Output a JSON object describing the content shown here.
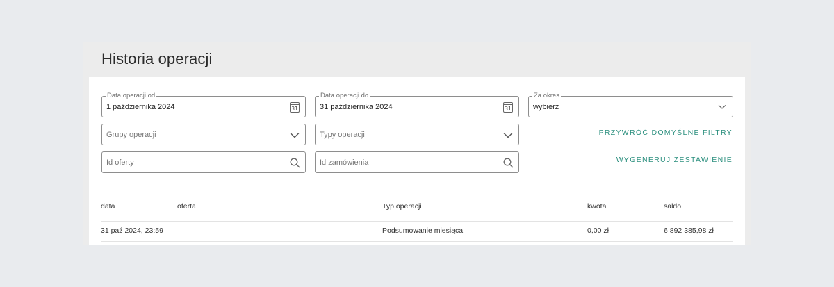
{
  "page": {
    "title": "Historia operacji"
  },
  "filters": {
    "date_from": {
      "label": "Data operacji od",
      "value": "1 października 2024",
      "icon": "calendar-icon",
      "icon_text": "31"
    },
    "date_to": {
      "label": "Data operacji do",
      "value": "31 października 2024",
      "icon": "calendar-icon",
      "icon_text": "31"
    },
    "period": {
      "label": "Za okres",
      "value": "wybierz",
      "icon": "chevron-down-icon"
    },
    "operation_groups": {
      "placeholder": "Grupy operacji",
      "icon": "chevron-down-icon"
    },
    "operation_types": {
      "placeholder": "Typy operacji",
      "icon": "chevron-down-icon"
    },
    "offer_id": {
      "placeholder": "Id oferty",
      "icon": "search-icon"
    },
    "order_id": {
      "placeholder": "Id zamówienia",
      "icon": "search-icon"
    },
    "reset_label": "PRZYWRÓĆ DOMYŚLNE FILTRY",
    "generate_label": "WYGENERUJ ZESTAWIENIE"
  },
  "table": {
    "headers": {
      "date": "data",
      "offer": "oferta",
      "type": "Typ operacji",
      "amount": "kwota",
      "balance": "saldo"
    },
    "rows": [
      {
        "date": "31 paź 2024, 23:59",
        "offer": "",
        "type": "Podsumowanie miesiąca",
        "amount": "0,00 zł",
        "balance": "6 892 385,98 zł"
      }
    ]
  },
  "colors": {
    "accent": "#2b8f7e",
    "background": "#e9ebee"
  }
}
